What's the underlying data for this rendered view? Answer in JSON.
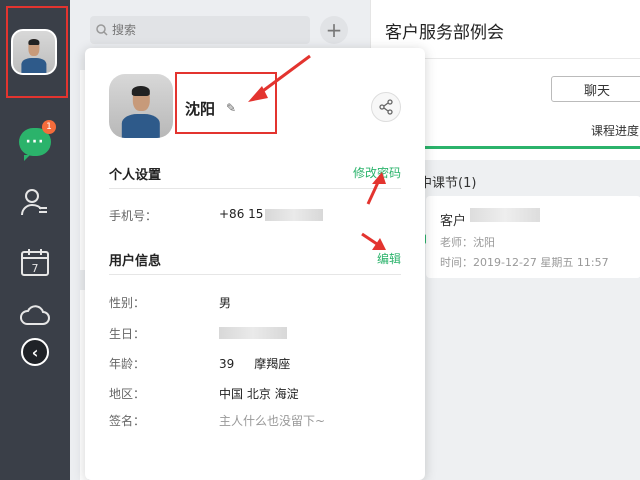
{
  "sidebar": {
    "chat_badge": "1",
    "icons": [
      "chat-icon",
      "contacts-icon",
      "calendar-icon",
      "cloud-icon",
      "collapse-icon"
    ],
    "calendar_day": "7"
  },
  "search": {
    "placeholder": "搜索"
  },
  "chat_title": "客户服务部例会",
  "chat_button": "聊天",
  "progress_tab": "课程进度",
  "section_label": "中课节(1)",
  "card": {
    "name": "客户",
    "teacher": "老师：沈阳",
    "time": "时间：2019-12-27 星期五 11:57"
  },
  "profile": {
    "name": "沈阳",
    "personal_settings": "个人设置",
    "change_password": "修改密码",
    "phone_label": "手机号：",
    "phone_value": "+86 15",
    "user_info": "用户信息",
    "edit": "编辑",
    "gender_label": "性别：",
    "gender_value": "男",
    "birthday_label": "生日：",
    "age_label": "年龄：",
    "age_value": "39",
    "zodiac": "摩羯座",
    "region_label": "地区：",
    "region_value": "中国 北京 海淀",
    "signature_label": "签名：",
    "signature_value": "主人什么也没留下~"
  },
  "colors": {
    "accent": "#2bb36b",
    "annotation": "#e3342f",
    "sidebar": "#3a3f48"
  }
}
